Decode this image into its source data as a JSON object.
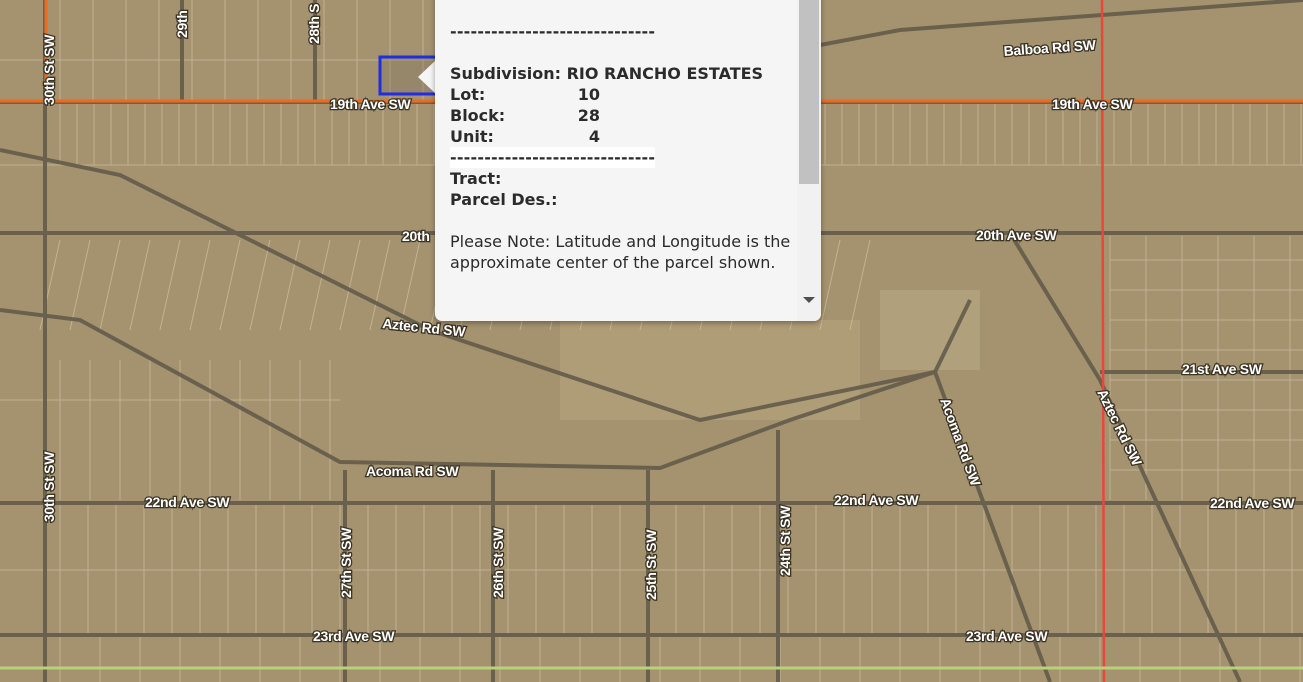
{
  "map": {
    "road_labels": [
      {
        "id": "balboa-rd",
        "text": "Balboa Rd SW"
      },
      {
        "id": "19th-ave-left",
        "text": "19th Ave SW"
      },
      {
        "id": "19th-ave-right",
        "text": "19th Ave SW"
      },
      {
        "id": "20th-ave-left",
        "text": "20th"
      },
      {
        "id": "20th-ave-right",
        "text": "20th Ave SW"
      },
      {
        "id": "aztec-rd-left",
        "text": "Aztec Rd SW"
      },
      {
        "id": "21st-ave",
        "text": "21st Ave SW"
      },
      {
        "id": "acoma-rd-sw",
        "text": "Acoma Rd SW"
      },
      {
        "id": "acoma-rd-diag",
        "text": "Acoma Rd SW"
      },
      {
        "id": "aztec-rd-diag",
        "text": "Aztec Rd SW"
      },
      {
        "id": "22nd-ave-left",
        "text": "22nd Ave SW"
      },
      {
        "id": "22nd-ave-mid",
        "text": "22nd Ave SW"
      },
      {
        "id": "22nd-ave-right",
        "text": "22nd Ave SW"
      },
      {
        "id": "23rd-ave-left",
        "text": "23rd Ave SW"
      },
      {
        "id": "23rd-ave-right",
        "text": "23rd Ave SW"
      },
      {
        "id": "30th-st-top",
        "text": "30th St SW"
      },
      {
        "id": "30th-st-bottom",
        "text": "30th St SW"
      },
      {
        "id": "29th-st",
        "text": "29th"
      },
      {
        "id": "28th-st-top",
        "text": "28th S"
      },
      {
        "id": "27th-st",
        "text": "27th St SW"
      },
      {
        "id": "26th-st",
        "text": "26th St SW"
      },
      {
        "id": "25th-st",
        "text": "25th St SW"
      },
      {
        "id": "24th-st",
        "text": "24th St SW"
      }
    ],
    "colors": {
      "terrain": "#a5936f",
      "road": "#5f5848",
      "orange_line": "#f06a1e",
      "red_line": "#e8473a",
      "green_line": "#b9d17a",
      "selected_parcel": "#1f2ee0"
    }
  },
  "popup": {
    "divider": "------------------------------",
    "subdivision_label": "Subdivision:",
    "subdivision_value": "RIO RANCHO ESTATES",
    "lot_label": "Lot:",
    "lot_value": "10",
    "block_label": "Block:",
    "block_value": "28",
    "unit_label": "Unit:",
    "unit_value": "4",
    "tract_label": "Tract:",
    "parcel_des_label": "Parcel Des.:",
    "note": "Please Note: Latitude and Longitude is the approximate center of the parcel shown."
  }
}
